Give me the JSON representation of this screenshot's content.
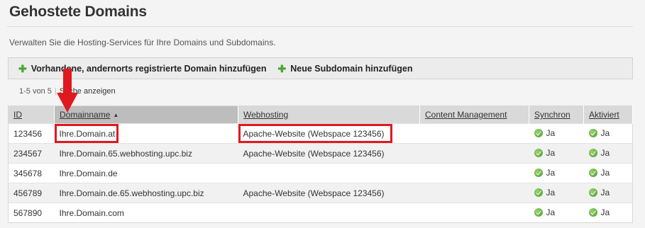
{
  "page": {
    "title": "Gehostete Domains",
    "description": "Verwalten Sie die Hosting-Services für Ihre Domains und Subdomains."
  },
  "toolbar": {
    "add_external_domain": "Vorhandene, andernorts registrierte Domain hinzufügen",
    "add_subdomain": "Neue Subdomain hinzufügen"
  },
  "pager": {
    "range": "1-5 von 5",
    "search_link": "Suche anzeigen"
  },
  "table": {
    "columns": {
      "id": "ID",
      "domainname": "Domainname",
      "webhosting": "Webhosting",
      "content_management": "Content Management",
      "synchron": "Synchron",
      "aktiviert": "Aktiviert"
    },
    "rows": [
      {
        "id": "123456",
        "domain": "Ihre.Domain.at",
        "webhosting": "Apache-Website (Webspace 123456)",
        "cms": "",
        "synchron": "Ja",
        "aktiviert": "Ja"
      },
      {
        "id": "234567",
        "domain": "Ihre.Domain.65.webhosting.upc.biz",
        "webhosting": "Apache-Website (Webspace 123456)",
        "cms": "",
        "synchron": "Ja",
        "aktiviert": "Ja"
      },
      {
        "id": "345678",
        "domain": "Ihre.Domain.de",
        "webhosting": "",
        "cms": "",
        "synchron": "Ja",
        "aktiviert": "Ja"
      },
      {
        "id": "456789",
        "domain": "Ihre.Domain.de.65.webhosting.upc.biz",
        "webhosting": "Apache-Website (Webspace 123456)",
        "cms": "",
        "synchron": "Ja",
        "aktiviert": "Ja"
      },
      {
        "id": "567890",
        "domain": "Ihre.Domain.com",
        "webhosting": "",
        "cms": "",
        "synchron": "Ja",
        "aktiviert": "Ja"
      }
    ]
  },
  "colors": {
    "annotation_red": "#e0191f",
    "plus_green": "#4aa82c",
    "check_green": "#4a9a2a"
  },
  "icons": [
    "plus-icon",
    "sort-ascending-icon",
    "check-circle-icon",
    "annotation-arrow-icon"
  ]
}
